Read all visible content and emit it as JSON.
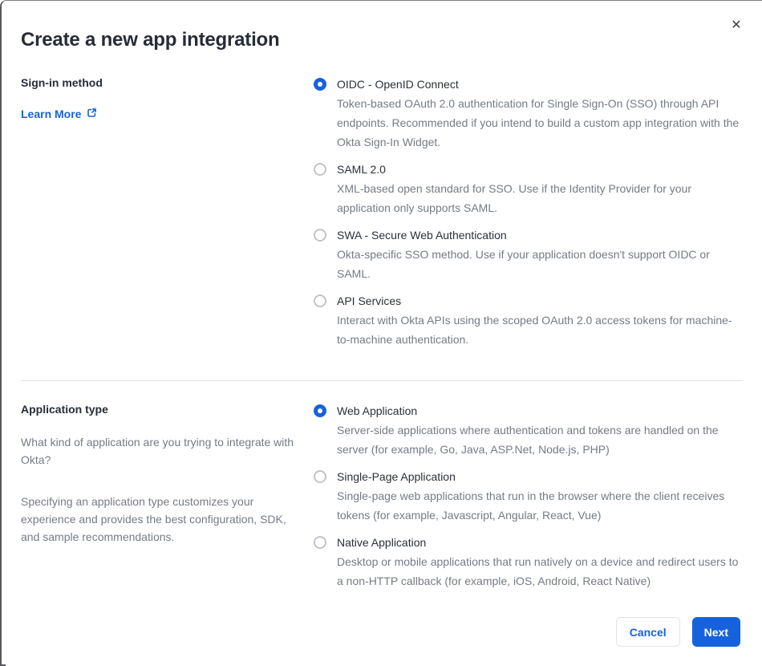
{
  "modal": {
    "title": "Create a new app integration",
    "close_glyph": "✕"
  },
  "signin_section": {
    "label": "Sign-in method",
    "learn_more_label": "Learn More",
    "options": [
      {
        "label": "OIDC - OpenID Connect",
        "description": "Token-based OAuth 2.0 authentication for Single Sign-On (SSO) through API endpoints. Recommended if you intend to build a custom app integration with the Okta Sign-In Widget.",
        "selected": true
      },
      {
        "label": "SAML 2.0",
        "description": "XML-based open standard for SSO. Use if the Identity Provider for your application only supports SAML.",
        "selected": false
      },
      {
        "label": "SWA - Secure Web Authentication",
        "description": "Okta-specific SSO method. Use if your application doesn't support OIDC or SAML.",
        "selected": false
      },
      {
        "label": "API Services",
        "description": "Interact with Okta APIs using the scoped OAuth 2.0 access tokens for machine-to-machine authentication.",
        "selected": false
      }
    ]
  },
  "apptype_section": {
    "label": "Application type",
    "paragraph_1": "What kind of application are you trying to integrate with Okta?",
    "paragraph_2": "Specifying an application type customizes your experience and provides the best configuration, SDK, and sample recommendations.",
    "options": [
      {
        "label": "Web Application",
        "description": "Server-side applications where authentication and tokens are handled on the server (for example, Go, Java, ASP.Net, Node.js, PHP)",
        "selected": true
      },
      {
        "label": "Single-Page Application",
        "description": "Single-page web applications that run in the browser where the client receives tokens (for example, Javascript, Angular, React, Vue)",
        "selected": false
      },
      {
        "label": "Native Application",
        "description": "Desktop or mobile applications that run natively on a device and redirect users to a non-HTTP callback (for example, iOS, Android, React Native)",
        "selected": false
      }
    ]
  },
  "footer": {
    "cancel_label": "Cancel",
    "next_label": "Next"
  },
  "colors": {
    "accent_blue": "#1662dd",
    "text_dark": "#272c38",
    "text_gray": "#757b85",
    "divider": "#e2e2e5"
  }
}
